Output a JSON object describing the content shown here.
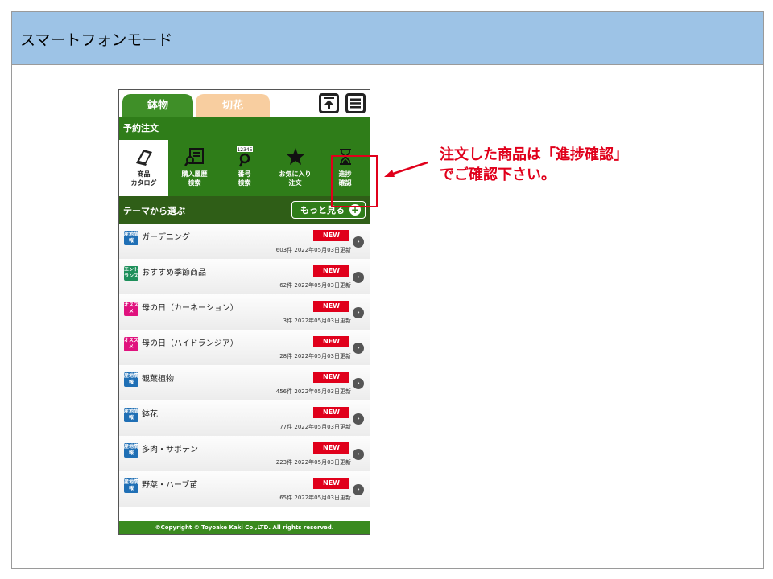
{
  "slide": {
    "title": "スマートフォンモード",
    "callout_line1": "注文した商品は「進捗確認」",
    "callout_line2": "でご確認下さい。"
  },
  "phone": {
    "tabs": [
      "鉢物",
      "切花"
    ],
    "section_title": "予約注文",
    "nav": [
      {
        "label1": "商品",
        "label2": "カタログ",
        "icon": "catalog-icon"
      },
      {
        "label1": "購入履歴",
        "label2": "検索",
        "icon": "history-search-icon"
      },
      {
        "label1": "番号",
        "label2": "検索",
        "icon": "number-search-icon",
        "icon_text": "12345"
      },
      {
        "label1": "お気に入り",
        "label2": "注文",
        "icon": "star-icon"
      },
      {
        "label1": "進捗",
        "label2": "確認",
        "icon": "hourglass-icon"
      }
    ],
    "theme_label": "テーマから選ぶ",
    "more_label": "もっと見る",
    "new_label": "NEW",
    "items": [
      {
        "name": "ガーデニング",
        "count": "603件",
        "date": "2022年05月03日更新",
        "tag": "産地情報",
        "tag_color": "#1f6fb5"
      },
      {
        "name": "おすすめ季節商品",
        "count": "62件",
        "date": "2022年05月03日更新",
        "tag": "エントランス",
        "tag_color": "#1d8f5a"
      },
      {
        "name": "母の日（カーネーション）",
        "count": "3件",
        "date": "2022年05月03日更新",
        "tag": "オススメ",
        "tag_color": "#e0127e"
      },
      {
        "name": "母の日（ハイドランジア）",
        "count": "28件",
        "date": "2022年05月03日更新",
        "tag": "オススメ",
        "tag_color": "#e0127e"
      },
      {
        "name": "観葉植物",
        "count": "456件",
        "date": "2022年05月03日更新",
        "tag": "産地情報",
        "tag_color": "#1f6fb5"
      },
      {
        "name": "鉢花",
        "count": "77件",
        "date": "2022年05月03日更新",
        "tag": "産地情報",
        "tag_color": "#1f6fb5"
      },
      {
        "name": "多肉・サボテン",
        "count": "223件",
        "date": "2022年05月03日更新",
        "tag": "産地情報",
        "tag_color": "#1f6fb5"
      },
      {
        "name": "野菜・ハーブ苗",
        "count": "65件",
        "date": "2022年05月03日更新",
        "tag": "産地情報",
        "tag_color": "#1f6fb5"
      }
    ],
    "footer": "©Copyright © Toyoake Kaki Co.,LTD. All rights reserved."
  },
  "colors": {
    "header_bg": "#9dc3e6",
    "green": "#2f7d19",
    "dark_green": "#2f5e17",
    "accent_red": "#e0001b",
    "tab_inactive": "#f8cea0"
  }
}
